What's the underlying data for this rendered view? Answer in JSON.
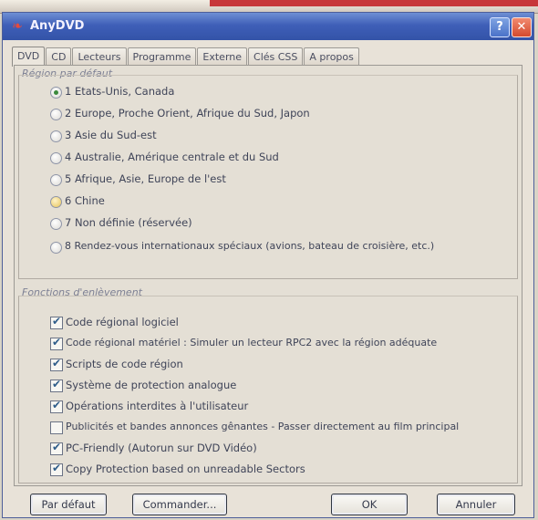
{
  "window": {
    "title": "AnyDVD",
    "help_label": "?",
    "close_label": "✕"
  },
  "tabs": [
    {
      "label": "DVD"
    },
    {
      "label": "CD"
    },
    {
      "label": "Lecteurs"
    },
    {
      "label": "Programme"
    },
    {
      "label": "Externe"
    },
    {
      "label": "Clés CSS"
    },
    {
      "label": "A propos"
    }
  ],
  "region_group": {
    "label": "Région par défaut",
    "options": [
      {
        "label": "1 Etats-Unis, Canada",
        "selected": true
      },
      {
        "label": "2 Europe, Proche Orient, Afrique du Sud, Japon",
        "selected": false
      },
      {
        "label": "3 Asie du Sud-est",
        "selected": false
      },
      {
        "label": "4 Australie, Amérique centrale et du Sud",
        "selected": false
      },
      {
        "label": "5 Afrique, Asie, Europe de l'est",
        "selected": false
      },
      {
        "label": "6 Chine",
        "selected": false
      },
      {
        "label": "7 Non définie (réservée)",
        "selected": false
      },
      {
        "label": "8 Rendez-vous internationaux spéciaux (avions, bateau de croisière, etc.)",
        "selected": false
      }
    ]
  },
  "features_group": {
    "label": "Fonctions d'enlèvement",
    "options": [
      {
        "label": "Code régional logiciel",
        "checked": true
      },
      {
        "label": "Code régional matériel : Simuler un lecteur RPC2 avec la région adéquate",
        "checked": true
      },
      {
        "label": "Scripts de code région",
        "checked": true
      },
      {
        "label": "Système de protection analogue",
        "checked": true
      },
      {
        "label": "Opérations interdites à l'utilisateur",
        "checked": true
      },
      {
        "label": "Publicités et bandes annonces gênantes - Passer directement au film principal",
        "checked": false
      },
      {
        "label": "PC-Friendly (Autorun sur DVD Vidéo)",
        "checked": true
      },
      {
        "label": "Copy Protection based on unreadable Sectors",
        "checked": true
      }
    ]
  },
  "buttons": {
    "default": "Par défaut",
    "order": "Commander...",
    "ok": "OK",
    "cancel": "Annuler"
  }
}
